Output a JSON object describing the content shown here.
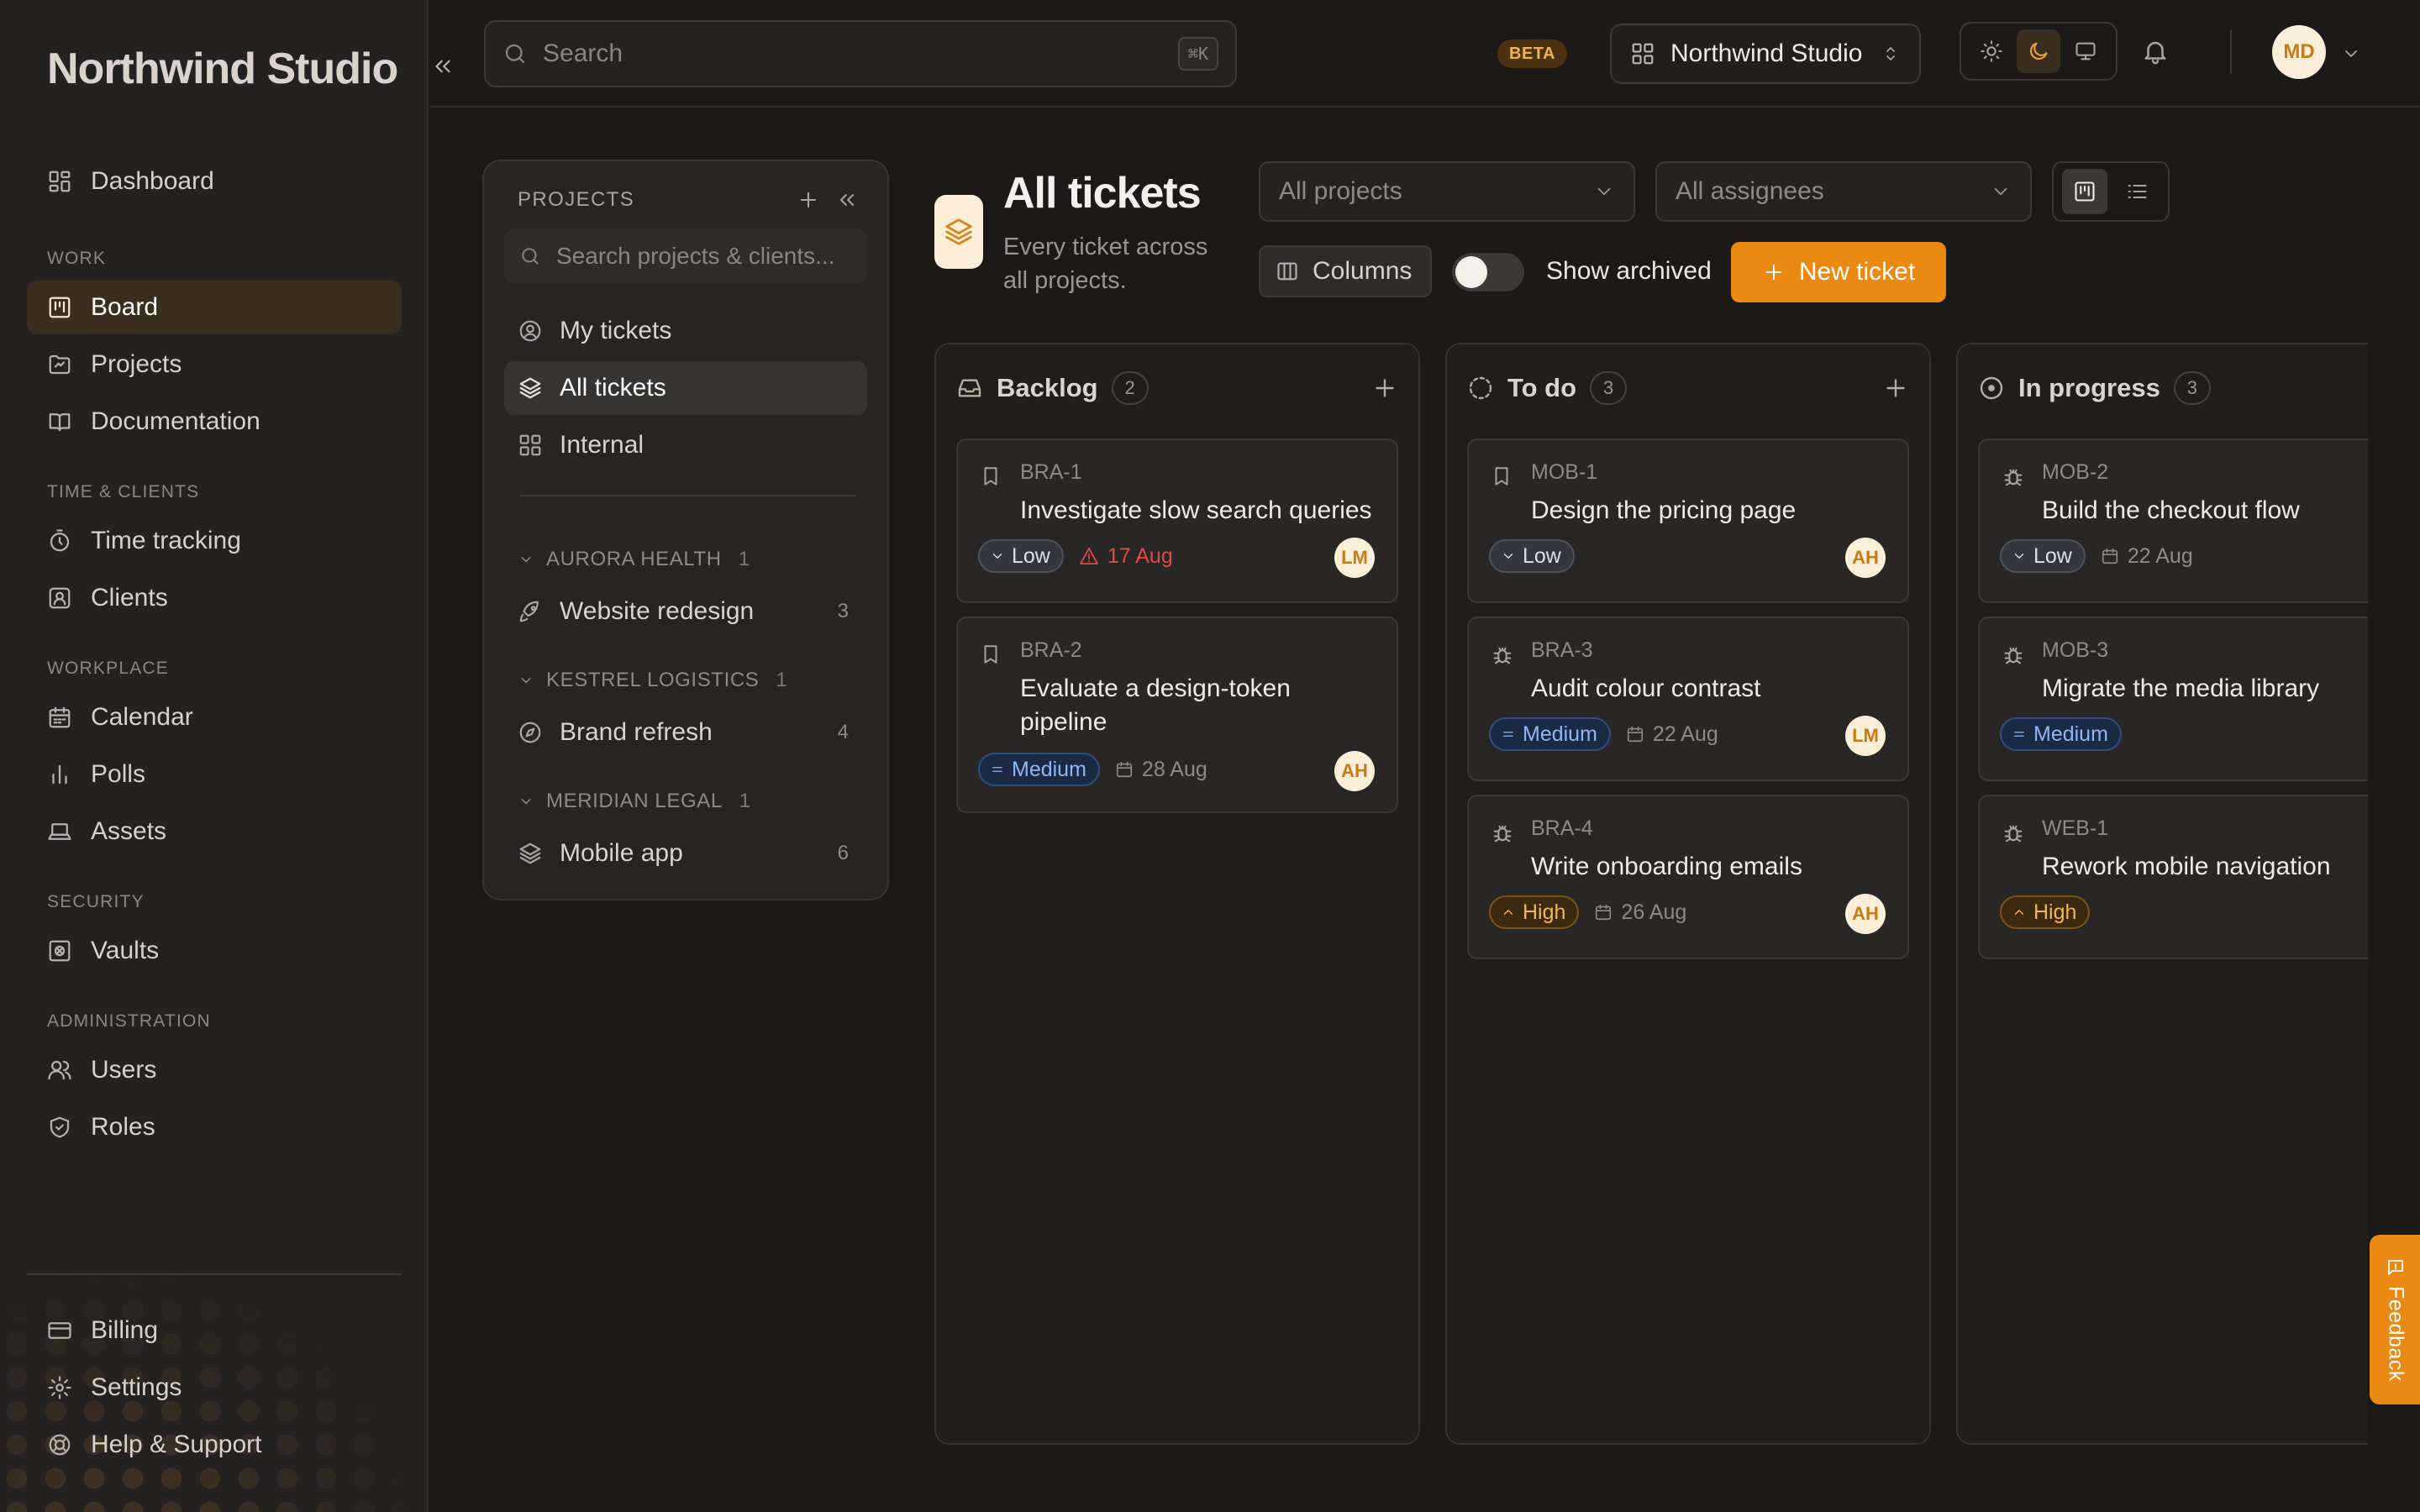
{
  "sidebar": {
    "brand": "Northwind Studio",
    "top_items": [
      {
        "label": "Dashboard",
        "icon": "dashboard-icon"
      }
    ],
    "sections": [
      {
        "title": "WORK",
        "items": [
          {
            "label": "Board",
            "icon": "board-icon",
            "active": true
          },
          {
            "label": "Projects",
            "icon": "folder-icon"
          },
          {
            "label": "Documentation",
            "icon": "book-icon"
          }
        ]
      },
      {
        "title": "TIME & CLIENTS",
        "items": [
          {
            "label": "Time tracking",
            "icon": "stopwatch-icon"
          },
          {
            "label": "Clients",
            "icon": "contact-icon"
          }
        ]
      },
      {
        "title": "WORKPLACE",
        "items": [
          {
            "label": "Calendar",
            "icon": "calendar-icon"
          },
          {
            "label": "Polls",
            "icon": "bar-chart-icon"
          },
          {
            "label": "Assets",
            "icon": "laptop-icon"
          }
        ]
      },
      {
        "title": "SECURITY",
        "items": [
          {
            "label": "Vaults",
            "icon": "vault-icon"
          }
        ]
      },
      {
        "title": "ADMINISTRATION",
        "items": [
          {
            "label": "Users",
            "icon": "users-icon"
          },
          {
            "label": "Roles",
            "icon": "shield-icon"
          }
        ]
      }
    ],
    "bottom_items": [
      {
        "label": "Billing",
        "icon": "credit-card-icon"
      },
      {
        "label": "Settings",
        "icon": "gear-icon"
      },
      {
        "label": "Help & Support",
        "icon": "lifebuoy-icon"
      }
    ]
  },
  "topbar": {
    "search_placeholder": "Search",
    "search_shortcut": "⌘K",
    "beta_label": "BETA",
    "workspace_name": "Northwind Studio",
    "user_initials": "MD",
    "theme_active": "dark"
  },
  "projects_panel": {
    "title": "PROJECTS",
    "search_placeholder": "Search projects & clients...",
    "views": [
      {
        "label": "My tickets",
        "icon": "user-circle-icon"
      },
      {
        "label": "All tickets",
        "icon": "layers-icon",
        "active": true
      },
      {
        "label": "Internal",
        "icon": "grid-icon"
      }
    ],
    "groups": [
      {
        "client": "AURORA HEALTH",
        "count": "1",
        "project": {
          "label": "Website redesign",
          "count": "3",
          "icon": "rocket-icon"
        }
      },
      {
        "client": "KESTREL LOGISTICS",
        "count": "1",
        "project": {
          "label": "Brand refresh",
          "count": "4",
          "icon": "compass-icon"
        }
      },
      {
        "client": "MERIDIAN LEGAL",
        "count": "1",
        "project": {
          "label": "Mobile app",
          "count": "6",
          "icon": "layers-icon"
        }
      }
    ]
  },
  "page": {
    "title": "All tickets",
    "subtitle": "Every ticket across all projects.",
    "filter_projects": "All projects",
    "filter_assignees": "All assignees",
    "columns_label": "Columns",
    "show_archived_label": "Show archived",
    "show_archived": false,
    "new_ticket_label": "New ticket",
    "view_mode": "board"
  },
  "board": {
    "columns": [
      {
        "name": "Backlog",
        "count": "2",
        "icon": "inbox-icon",
        "cards": [
          {
            "key": "BRA-1",
            "title": "Investigate slow search queries",
            "type": "bookmark-icon",
            "priority": "Low",
            "date": "17 Aug",
            "overdue": true,
            "assignee": "LM"
          },
          {
            "key": "BRA-2",
            "title": "Evaluate a design-token pipeline",
            "type": "bookmark-icon",
            "priority": "Medium",
            "date": "28 Aug",
            "overdue": false,
            "assignee": "AH"
          }
        ]
      },
      {
        "name": "To do",
        "count": "3",
        "icon": "dashed-circle-icon",
        "cards": [
          {
            "key": "MOB-1",
            "title": "Design the pricing page",
            "type": "bookmark-icon",
            "priority": "Low",
            "date": "",
            "overdue": false,
            "assignee": "AH"
          },
          {
            "key": "BRA-3",
            "title": "Audit colour contrast",
            "type": "bug-icon",
            "priority": "Medium",
            "date": "22 Aug",
            "overdue": false,
            "assignee": "LM"
          },
          {
            "key": "BRA-4",
            "title": "Write onboarding emails",
            "type": "bug-icon",
            "priority": "High",
            "date": "26 Aug",
            "overdue": false,
            "assignee": "AH"
          }
        ]
      },
      {
        "name": "In progress",
        "count": "3",
        "icon": "dot-circle-icon",
        "cards": [
          {
            "key": "MOB-2",
            "title": "Build the checkout flow",
            "type": "bug-icon",
            "priority": "Low",
            "date": "22 Aug",
            "overdue": false,
            "assignee": ""
          },
          {
            "key": "MOB-3",
            "title": "Migrate the media library",
            "type": "bug-icon",
            "priority": "Medium",
            "date": "",
            "overdue": false,
            "assignee": ""
          },
          {
            "key": "WEB-1",
            "title": "Rework mobile navigation",
            "type": "bug-icon",
            "priority": "High",
            "date": "",
            "overdue": false,
            "assignee": ""
          }
        ]
      }
    ]
  },
  "feedback_label": "Feedback",
  "colors": {
    "accent": "#ea8a12",
    "active_nav": "#3a2e1e",
    "overdue": "#e04848",
    "medium": "#8fb6f2",
    "high": "#f2b650"
  }
}
